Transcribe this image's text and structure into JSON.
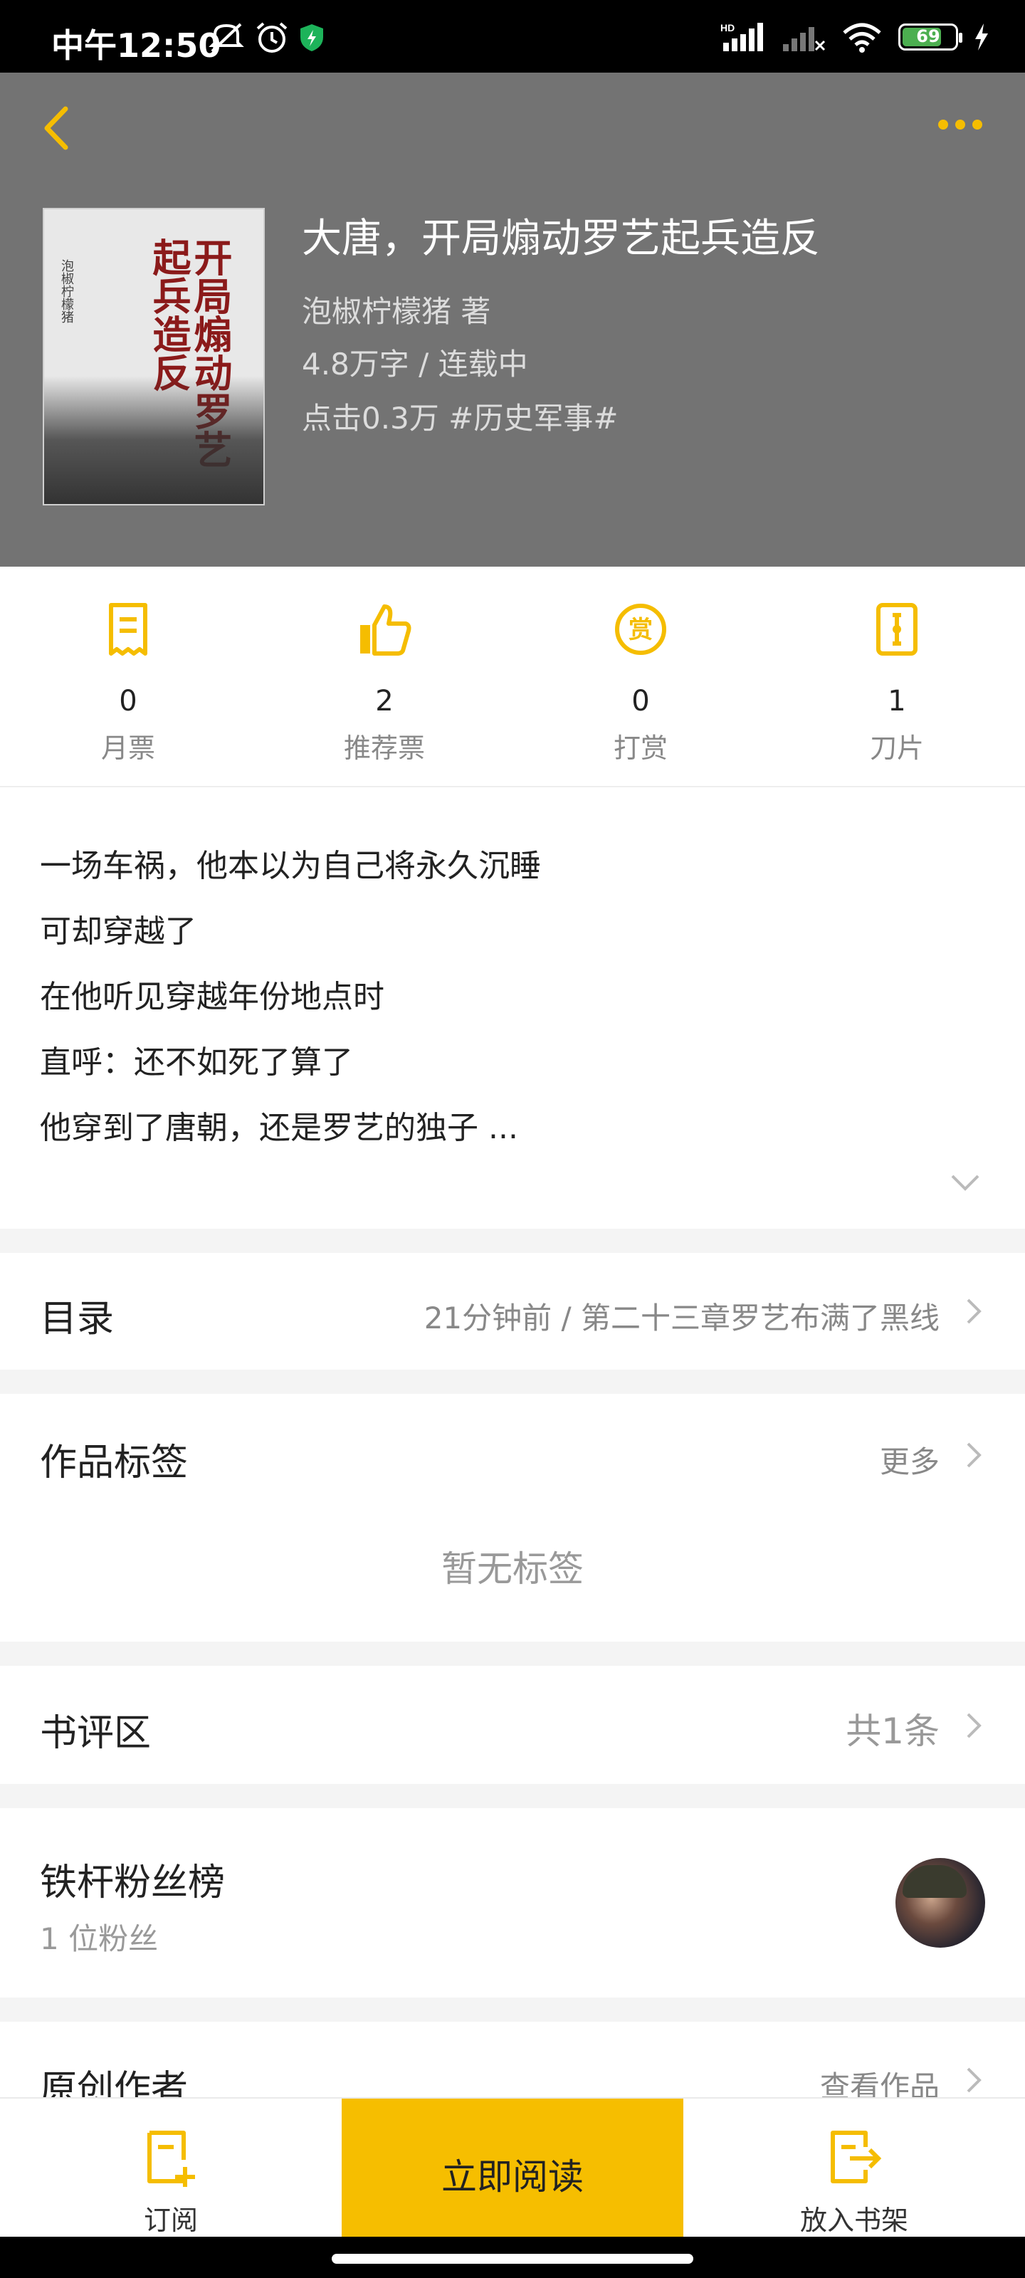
{
  "status_bar": {
    "time": "中午12:50",
    "battery_level": "69",
    "icons": [
      "mute-icon",
      "alarm-icon",
      "shield-icon",
      "hd-signal-icon",
      "signal-off-icon",
      "wifi-icon",
      "battery-icon",
      "charging-icon"
    ]
  },
  "book": {
    "title": "大唐，开局煽动罗艺起兵造反",
    "author": "泡椒柠檬猪  著",
    "meta": "4.8万字 / 连载中",
    "clicks": "点击0.3万  #历史军事#",
    "cover_title": "开局煽动罗艺起兵造反",
    "cover_author": "泡椒柠檬猪"
  },
  "stats": [
    {
      "icon": "monthly-ticket-icon",
      "value": "0",
      "label": "月票"
    },
    {
      "icon": "thumbs-up-icon",
      "value": "2",
      "label": "推荐票"
    },
    {
      "icon": "reward-icon",
      "value": "0",
      "label": "打赏"
    },
    {
      "icon": "blade-icon",
      "value": "1",
      "label": "刀片"
    }
  ],
  "intro": {
    "lines": [
      "一场车祸，他本以为自己将永久沉睡",
      "可却穿越了",
      "在他听见穿越年份地点时",
      "直呼：还不如死了算了",
      "他穿到了唐朝，还是罗艺的独子 ..."
    ]
  },
  "catalog": {
    "title": "目录",
    "latest": "21分钟前 / 第二十三章罗艺布满了黑线"
  },
  "tags": {
    "title": "作品标签",
    "more": "更多",
    "empty": "暂无标签"
  },
  "reviews": {
    "title": "书评区",
    "count": "共1条"
  },
  "fans": {
    "title": "铁杆粉丝榜",
    "subtitle": "1 位粉丝"
  },
  "author_row": {
    "title": "原创作者",
    "action": "查看作品"
  },
  "bottom_bar": {
    "subscribe": "订阅",
    "read": "立即阅读",
    "shelf": "放入书架"
  },
  "colors": {
    "accent": "#f5bd00",
    "header_bg": "#737373"
  }
}
